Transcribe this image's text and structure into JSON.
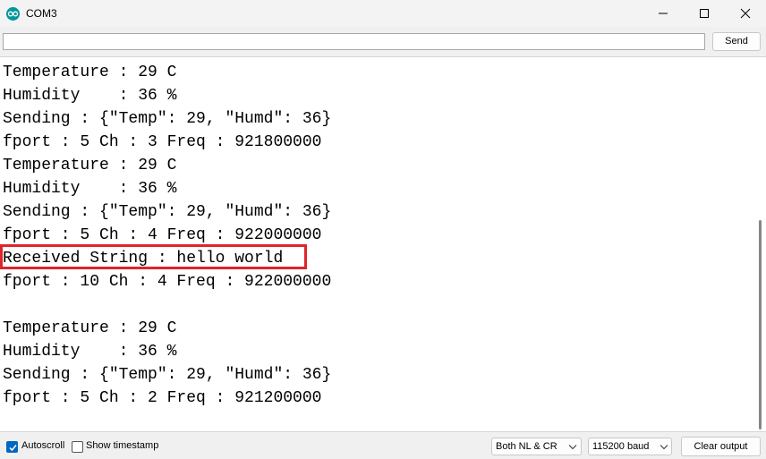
{
  "window": {
    "title": "COM3",
    "app_icon": "arduino-icon",
    "controls": [
      "minimize-icon",
      "maximize-icon",
      "close-icon"
    ]
  },
  "input": {
    "value": "",
    "placeholder": ""
  },
  "toolbar": {
    "send_label": "Send"
  },
  "output": {
    "lines": [
      "Temperature : 29 C",
      "Humidity    : 36 %",
      "Sending : {\"Temp\": 29, \"Humd\": 36}",
      "fport : 5 Ch : 3 Freq : 921800000",
      "Temperature : 29 C",
      "Humidity    : 36 %",
      "Sending : {\"Temp\": 29, \"Humd\": 36}",
      "fport : 5 Ch : 4 Freq : 922000000",
      "Received String : hello world",
      "fport : 10 Ch : 4 Freq : 922000000",
      "",
      "Temperature : 29 C",
      "Humidity    : 36 %",
      "Sending : {\"Temp\": 29, \"Humd\": 36}",
      "fport : 5 Ch : 2 Freq : 921200000"
    ],
    "highlighted_line": "Received String : hello world",
    "highlight_color": "#e0242c"
  },
  "footer": {
    "autoscroll_label": "Autoscroll",
    "autoscroll_checked": true,
    "timestamp_label": "Show timestamp",
    "timestamp_checked": false,
    "line_ending": "Both NL & CR",
    "baud_rate": "115200 baud",
    "clear_label": "Clear output"
  },
  "colors": {
    "accent": "#0067c0",
    "arduino": "#00979d"
  }
}
